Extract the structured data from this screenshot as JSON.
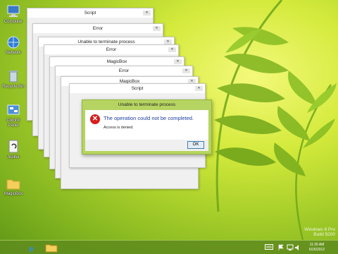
{
  "desktop": {
    "icons": [
      {
        "label": "Computer",
        "icon": "computer-icon"
      },
      {
        "label": "Network",
        "icon": "network-icon"
      },
      {
        "label": "Recycle Bin",
        "icon": "recycle-bin-icon"
      },
      {
        "label": "Control Panel",
        "icon": "control-panel-icon"
      },
      {
        "label": "Jupiter",
        "icon": "shortcut-icon"
      },
      {
        "label": "MagicBox",
        "icon": "folder-icon"
      }
    ]
  },
  "stacked_windows": [
    {
      "title": "Script"
    },
    {
      "title": "Error"
    },
    {
      "title": "Unable to terminate process"
    },
    {
      "title": "Error"
    },
    {
      "title": "MagicBox"
    },
    {
      "title": "Error"
    },
    {
      "title": "MagicBox"
    },
    {
      "title": "Script"
    }
  ],
  "dialog": {
    "title": "Unable to terminate process",
    "main_message": "The operation could not be completed.",
    "detail": "Access is denied.",
    "ok_label": "OK",
    "icon": "error-icon"
  },
  "taskbar": {
    "apps": [
      {
        "icon": "internet-explorer-icon"
      },
      {
        "icon": "file-explorer-icon"
      }
    ],
    "time": "11:26 AM",
    "date": "6/26/2012"
  },
  "watermark": {
    "line1": "Windows 8 Pro",
    "line2": "Build 9200"
  },
  "colors": {
    "accent": "#b6d461",
    "error_red": "#d71c1c",
    "message_blue": "#1a3e9e"
  }
}
